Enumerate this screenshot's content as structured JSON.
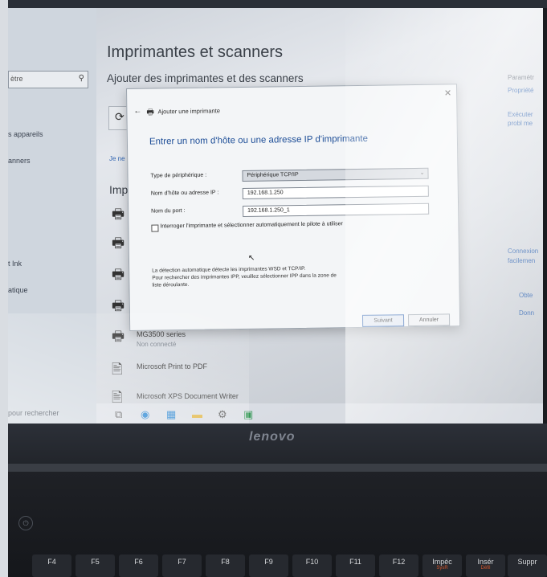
{
  "settings": {
    "title": "Imprimantes et scanners",
    "subtitle": "Ajouter des imprimantes et des scanners",
    "search_partial": "ètre",
    "nav_items": [
      "s appareils",
      "anners",
      "t Ink",
      "atique",
      "pour rechercher"
    ],
    "side_link": "Je ne",
    "list_heading": "Imp",
    "printers": [
      {
        "name": "",
        "status": ""
      },
      {
        "name": "",
        "status": ""
      },
      {
        "name": "",
        "status": ""
      },
      {
        "name": "",
        "status": ""
      },
      {
        "name": "MG3500 series",
        "status": "Non connecté"
      },
      {
        "name": "Microsoft Print to PDF",
        "status": ""
      },
      {
        "name": "Microsoft XPS Document Writer",
        "status": ""
      }
    ],
    "right_column": [
      "Paramètr",
      "Propriété",
      "Exécuter",
      "probl me",
      "Connexion",
      "facilemen",
      "Obte",
      "Donn"
    ]
  },
  "dialog": {
    "window_title": "Ajouter une imprimante",
    "heading": "Entrer un nom d'hôte ou une adresse IP d'imprimante",
    "device_type_label": "Type de périphérique :",
    "device_type_value": "Périphérique TCP/IP",
    "host_label": "Nom d'hôte ou adresse IP :",
    "host_value": "192.168.1.250",
    "port_label": "Nom du port :",
    "port_value": "192.168.1.250_1",
    "checkbox_label": "Interroger l'imprimante et sélectionner automatiquement le pilote à utiliser",
    "checkbox_checked": false,
    "info_line1": "La détection automatique détecte les imprimantes WSD et TCP/IP.",
    "info_line2": "Pour rechercher des imprimantes IPP, veuillez sélectionner IPP dans la zone de",
    "info_line3": "liste déroulante.",
    "next_button": "Suivant",
    "cancel_button": "Annuler"
  },
  "laptop": {
    "brand": "lenovo",
    "keys": [
      {
        "label": "F4",
        "sub": ""
      },
      {
        "label": "F5",
        "sub": ""
      },
      {
        "label": "F6",
        "sub": ""
      },
      {
        "label": "F7",
        "sub": ""
      },
      {
        "label": "F8",
        "sub": ""
      },
      {
        "label": "F9",
        "sub": ""
      },
      {
        "label": "F10",
        "sub": ""
      },
      {
        "label": "F11",
        "sub": ""
      },
      {
        "label": "F12",
        "sub": ""
      },
      {
        "label": "Impéc",
        "sub": "SysR"
      },
      {
        "label": "Insér",
        "sub": "Défil"
      },
      {
        "label": "Suppr",
        "sub": ""
      }
    ]
  },
  "colors": {
    "accent": "#2f63b0",
    "heading_blue": "#1f4f98",
    "key_secondary": "#d4572c"
  }
}
